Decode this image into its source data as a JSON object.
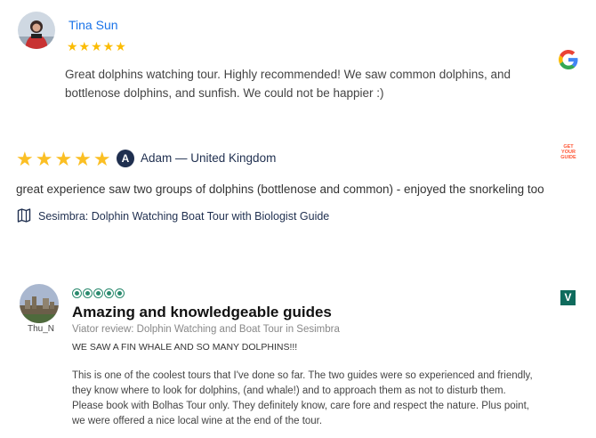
{
  "colors": {
    "google_blue": "#1a73e8",
    "star_yellow": "#fbbc04",
    "gyg_orange": "#ff5533",
    "viator_green": "#0f6b5d",
    "navy": "#1f2f4f"
  },
  "review1": {
    "source_icon": "google-logo",
    "author": "Tina Sun",
    "stars": "★★★★★",
    "rating": 5,
    "text": "Great dolphins watching tour. Highly recommended! We saw common dolphins, and bottlenose dolphins, and sunfish. We could not be happier :)"
  },
  "review2": {
    "source_icon": "getyourguide-logo",
    "source_logo_text": "GET YOUR GUIDE",
    "stars": "★★★★★",
    "rating": 5,
    "author_initial": "A",
    "author": "Adam — United Kingdom",
    "text": "great experience saw two groups of dolphins (bottlenose and common) - enjoyed the snorkeling too",
    "tour": "Sesimbra: Dolphin Watching Boat Tour with Biologist Guide"
  },
  "review3": {
    "source_icon": "viator-logo",
    "source_logo_letter": "V",
    "username": "Thu_N",
    "rating": 5,
    "title": "Amazing and knowledgeable guides",
    "source": "Viator review: Dolphin Watching and Boat Tour in Sesimbra",
    "heading": "WE SAW A FIN WHALE AND SO MANY DOLPHINS!!!",
    "body": "This is one of the coolest tours that I've done so far. The two guides were so experienced and friendly, they know where to look for dolphins, (and whale!) and to approach them as not to disturb them. Please book with Bolhas Tour only. They definitely know, care fore and respect the nature. Plus point, we were offered a nice local wine at the end of the tour."
  }
}
